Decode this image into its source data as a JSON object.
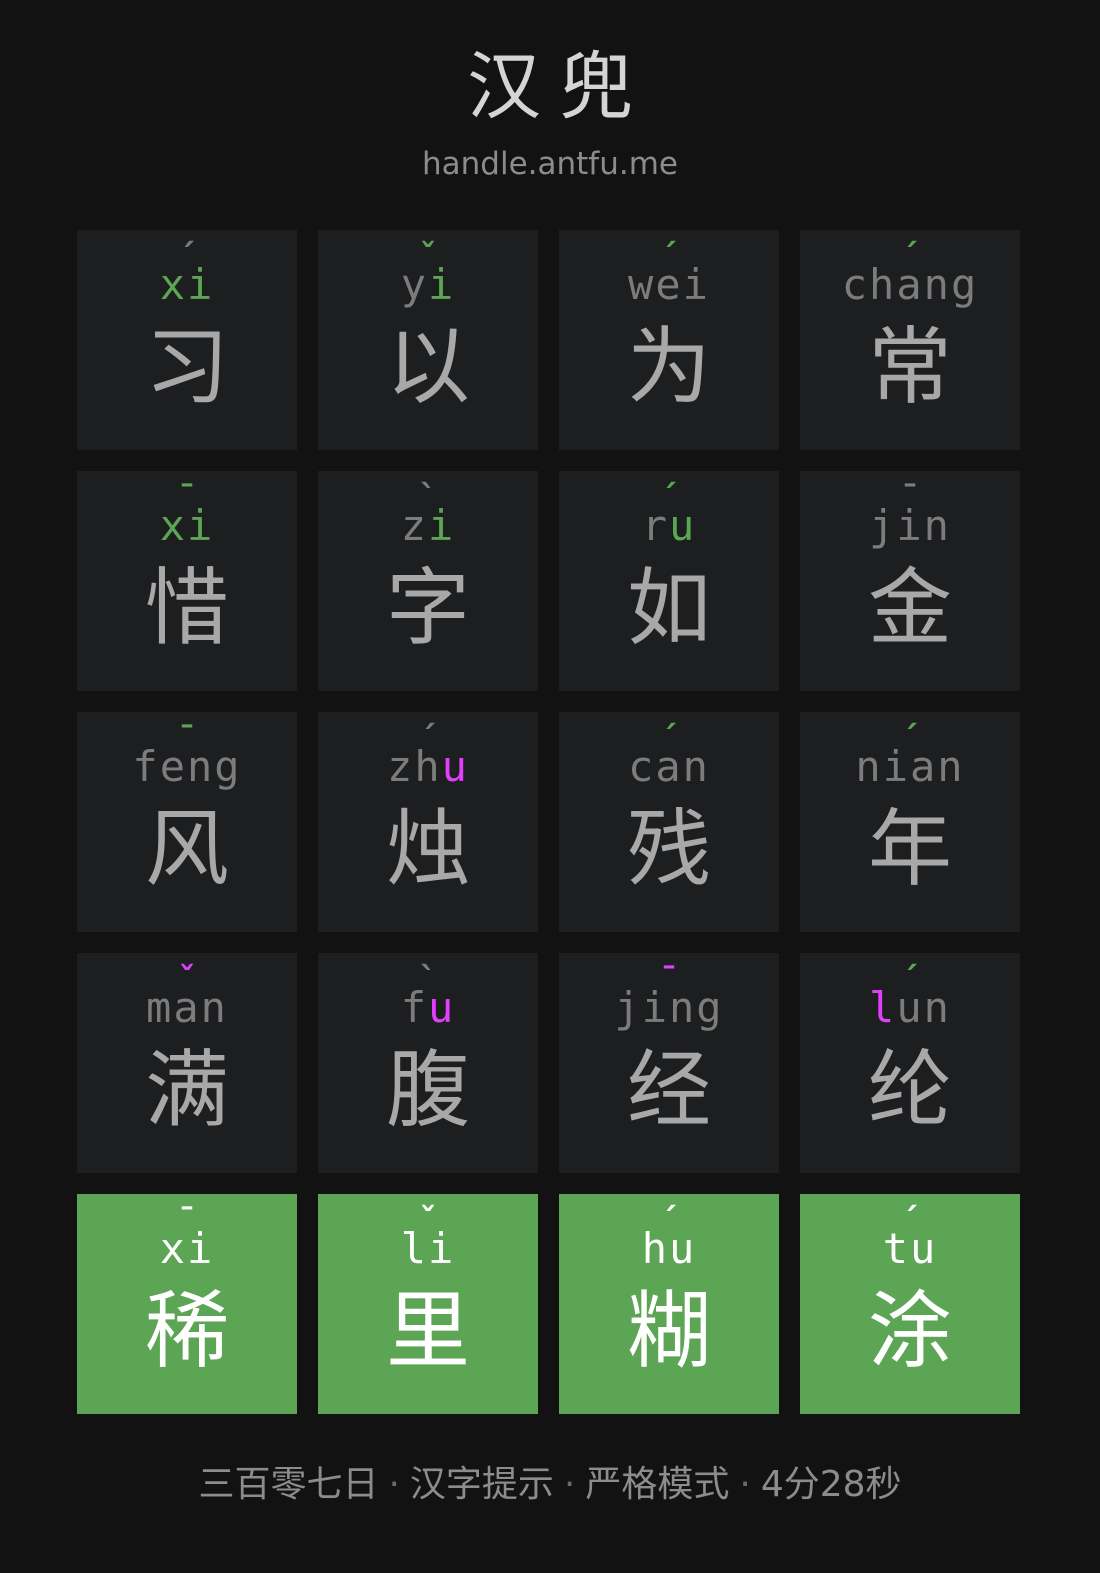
{
  "header": {
    "title": "汉兜",
    "url": "handle.antfu.me"
  },
  "colors": {
    "background": "#121212",
    "tile": "#1d1e20",
    "correct_tile": "#5ba554",
    "exact": "#5ba554",
    "misplaced": "#e040fb",
    "absent": "#7c7c7c"
  },
  "guesses": [
    [
      {
        "hanzi": "习",
        "pinyin": [
          {
            "t": "x",
            "s": "exact"
          },
          {
            "t": "i",
            "s": "exact"
          }
        ],
        "tone": {
          "mark": "ˊ",
          "s": "absent"
        }
      },
      {
        "hanzi": "以",
        "pinyin": [
          {
            "t": "y",
            "s": "absent"
          },
          {
            "t": "i",
            "s": "exact"
          }
        ],
        "tone": {
          "mark": "ˇ",
          "s": "exact"
        }
      },
      {
        "hanzi": "为",
        "pinyin": [
          {
            "t": "w",
            "s": "absent"
          },
          {
            "t": "e",
            "s": "absent"
          },
          {
            "t": "i",
            "s": "absent"
          }
        ],
        "tone": {
          "mark": "ˊ",
          "s": "exact"
        }
      },
      {
        "hanzi": "常",
        "pinyin": [
          {
            "t": "c",
            "s": "absent"
          },
          {
            "t": "h",
            "s": "absent"
          },
          {
            "t": "a",
            "s": "absent"
          },
          {
            "t": "n",
            "s": "absent"
          },
          {
            "t": "g",
            "s": "absent"
          }
        ],
        "tone": {
          "mark": "ˊ",
          "s": "exact"
        }
      }
    ],
    [
      {
        "hanzi": "惜",
        "pinyin": [
          {
            "t": "x",
            "s": "exact"
          },
          {
            "t": "i",
            "s": "exact"
          }
        ],
        "tone": {
          "mark": "ˉ",
          "s": "exact"
        }
      },
      {
        "hanzi": "字",
        "pinyin": [
          {
            "t": "z",
            "s": "absent"
          },
          {
            "t": "i",
            "s": "exact"
          }
        ],
        "tone": {
          "mark": "ˋ",
          "s": "absent"
        }
      },
      {
        "hanzi": "如",
        "pinyin": [
          {
            "t": "r",
            "s": "absent"
          },
          {
            "t": "u",
            "s": "exact"
          }
        ],
        "tone": {
          "mark": "ˊ",
          "s": "exact"
        }
      },
      {
        "hanzi": "金",
        "pinyin": [
          {
            "t": "j",
            "s": "absent"
          },
          {
            "t": "i",
            "s": "absent"
          },
          {
            "t": "n",
            "s": "absent"
          }
        ],
        "tone": {
          "mark": "ˉ",
          "s": "absent"
        }
      }
    ],
    [
      {
        "hanzi": "风",
        "pinyin": [
          {
            "t": "f",
            "s": "absent"
          },
          {
            "t": "e",
            "s": "absent"
          },
          {
            "t": "n",
            "s": "absent"
          },
          {
            "t": "g",
            "s": "absent"
          }
        ],
        "tone": {
          "mark": "ˉ",
          "s": "exact"
        }
      },
      {
        "hanzi": "烛",
        "pinyin": [
          {
            "t": "z",
            "s": "absent"
          },
          {
            "t": "h",
            "s": "absent"
          },
          {
            "t": "u",
            "s": "misplaced"
          }
        ],
        "tone": {
          "mark": "ˊ",
          "s": "absent"
        }
      },
      {
        "hanzi": "残",
        "pinyin": [
          {
            "t": "c",
            "s": "absent"
          },
          {
            "t": "a",
            "s": "absent"
          },
          {
            "t": "n",
            "s": "absent"
          }
        ],
        "tone": {
          "mark": "ˊ",
          "s": "exact"
        }
      },
      {
        "hanzi": "年",
        "pinyin": [
          {
            "t": "n",
            "s": "absent"
          },
          {
            "t": "i",
            "s": "absent"
          },
          {
            "t": "a",
            "s": "absent"
          },
          {
            "t": "n",
            "s": "absent"
          }
        ],
        "tone": {
          "mark": "ˊ",
          "s": "exact"
        }
      }
    ],
    [
      {
        "hanzi": "满",
        "pinyin": [
          {
            "t": "m",
            "s": "absent"
          },
          {
            "t": "a",
            "s": "absent"
          },
          {
            "t": "n",
            "s": "absent"
          }
        ],
        "tone": {
          "mark": "ˇ",
          "s": "misplaced"
        }
      },
      {
        "hanzi": "腹",
        "pinyin": [
          {
            "t": "f",
            "s": "absent"
          },
          {
            "t": "u",
            "s": "misplaced"
          }
        ],
        "tone": {
          "mark": "ˋ",
          "s": "absent"
        }
      },
      {
        "hanzi": "经",
        "pinyin": [
          {
            "t": "j",
            "s": "absent"
          },
          {
            "t": "i",
            "s": "absent"
          },
          {
            "t": "n",
            "s": "absent"
          },
          {
            "t": "g",
            "s": "absent"
          }
        ],
        "tone": {
          "mark": "ˉ",
          "s": "misplaced"
        }
      },
      {
        "hanzi": "纶",
        "pinyin": [
          {
            "t": "l",
            "s": "misplaced"
          },
          {
            "t": "u",
            "s": "absent"
          },
          {
            "t": "n",
            "s": "absent"
          }
        ],
        "tone": {
          "mark": "ˊ",
          "s": "exact"
        }
      }
    ],
    [
      {
        "hanzi": "稀",
        "pinyin": [
          {
            "t": "x",
            "s": "correct"
          },
          {
            "t": "i",
            "s": "correct"
          }
        ],
        "tone": {
          "mark": "ˉ",
          "s": "correct"
        },
        "correct": true
      },
      {
        "hanzi": "里",
        "pinyin": [
          {
            "t": "l",
            "s": "correct"
          },
          {
            "t": "i",
            "s": "correct"
          }
        ],
        "tone": {
          "mark": "ˇ",
          "s": "correct"
        },
        "correct": true
      },
      {
        "hanzi": "糊",
        "pinyin": [
          {
            "t": "h",
            "s": "correct"
          },
          {
            "t": "u",
            "s": "correct"
          }
        ],
        "tone": {
          "mark": "ˊ",
          "s": "correct"
        },
        "correct": true
      },
      {
        "hanzi": "涂",
        "pinyin": [
          {
            "t": "t",
            "s": "correct"
          },
          {
            "t": "u",
            "s": "correct"
          }
        ],
        "tone": {
          "mark": "ˊ",
          "s": "correct"
        },
        "correct": true
      }
    ]
  ],
  "footer": {
    "items": [
      "三百零七日",
      "汉字提示",
      "严格模式",
      "4分28秒"
    ],
    "separator": "·"
  }
}
